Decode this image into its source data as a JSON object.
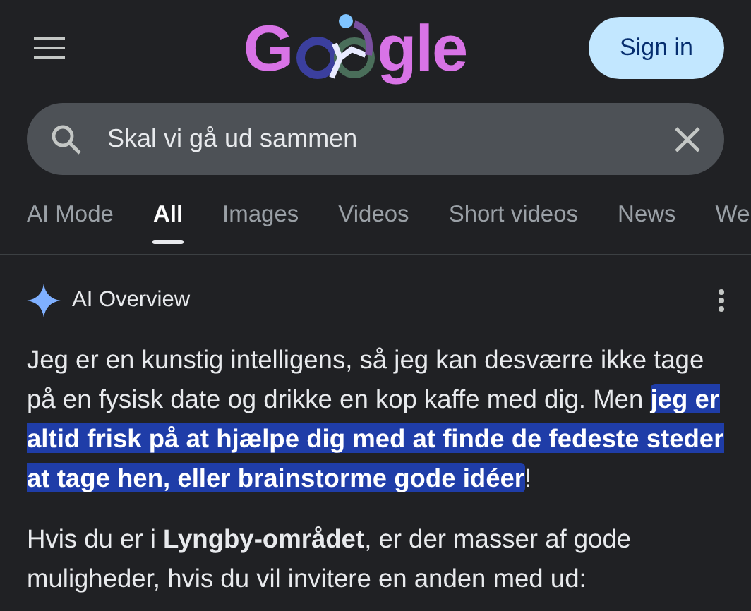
{
  "header": {
    "logo": {
      "before": "G",
      "after": "gle"
    },
    "sign_in": "Sign in"
  },
  "search": {
    "value": "Skal vi gå ud sammen"
  },
  "tabs": [
    {
      "label": "AI Mode",
      "selected": false
    },
    {
      "label": "All",
      "selected": true
    },
    {
      "label": "Images",
      "selected": false
    },
    {
      "label": "Videos",
      "selected": false
    },
    {
      "label": "Short videos",
      "selected": false
    },
    {
      "label": "News",
      "selected": false
    },
    {
      "label": "We",
      "selected": false
    }
  ],
  "overview": {
    "title": "AI Overview",
    "paragraphs": [
      [
        {
          "text": "Jeg er en kunstig intelligens, så jeg kan desværre ikke tage på en fysisk date og drikke en kop kaffe med dig. Men ",
          "highlighted": false
        },
        {
          "text": "jeg er altid frisk på at hjælpe dig med at finde de fedeste steder at tage hen, eller brainstorme gode idéer",
          "highlighted": true
        },
        {
          "text": "!",
          "highlighted": false
        }
      ],
      [
        {
          "text": "Hvis du er i **Lyngby-området**, er der masser af gode muligheder, hvis du vil invitere en anden med ud:",
          "highlighted": false
        }
      ]
    ]
  }
}
